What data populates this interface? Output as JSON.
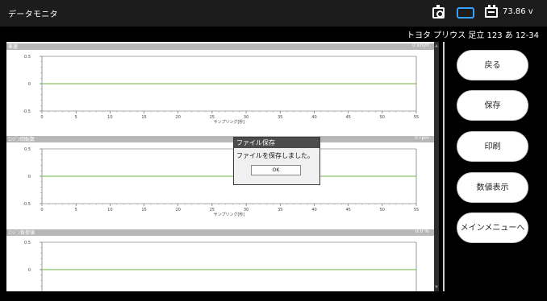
{
  "app": {
    "title": "データモニタ",
    "voltage": "73.86 v"
  },
  "header_icons": {
    "camera": "camera-icon",
    "connection": "vci-link-icon",
    "battery": "battery-icon",
    "connection_color": "#3aa0ff"
  },
  "vehicle": {
    "name": "トヨタ プリウス 足立 123 あ 12-34"
  },
  "charts": [
    {
      "label": "車速",
      "unit": "0 km/h",
      "xlabel": "サンプリング[秒]",
      "y_ticks": [
        "0.5",
        "0",
        "-0.5"
      ],
      "show_x_axis": true
    },
    {
      "label": "ｴﾝｼﾞﾝ回転数",
      "unit": "0 rpm",
      "xlabel": "サンプリング[秒]",
      "y_ticks": [
        "0.5",
        "0",
        "-0.5"
      ],
      "show_x_axis": true
    },
    {
      "label": "ｴﾝｼﾞﾝ負荷値",
      "unit": "0.0 %",
      "xlabel": "",
      "y_ticks": [
        "0.5",
        "0"
      ],
      "show_x_axis": false
    }
  ],
  "chart_data": [
    {
      "type": "line",
      "title": "車速",
      "xlabel": "サンプリング[秒]",
      "ylabel": "",
      "xlim": [
        0,
        55
      ],
      "ylim": [
        -0.5,
        0.5
      ],
      "x_ticks": [
        0,
        5,
        10,
        15,
        20,
        25,
        30,
        35,
        40,
        45,
        50,
        55
      ],
      "series": [
        {
          "x": [
            0,
            55
          ],
          "values": [
            0,
            0
          ]
        }
      ],
      "line_color": "#6db33f"
    },
    {
      "type": "line",
      "title": "ｴﾝｼﾞﾝ回転数",
      "xlabel": "サンプリング[秒]",
      "ylabel": "",
      "xlim": [
        0,
        55
      ],
      "ylim": [
        -0.5,
        0.5
      ],
      "x_ticks": [
        0,
        5,
        10,
        15,
        20,
        25,
        30,
        35,
        40,
        45,
        50,
        55
      ],
      "series": [
        {
          "x": [
            0,
            55
          ],
          "values": [
            0,
            0
          ]
        }
      ],
      "line_color": "#6db33f"
    },
    {
      "type": "line",
      "title": "ｴﾝｼﾞﾝ負荷値",
      "xlabel": "",
      "ylabel": "",
      "xlim": [
        0,
        55
      ],
      "ylim": [
        -0.5,
        0.5
      ],
      "x_ticks": [],
      "series": [
        {
          "x": [
            0,
            55
          ],
          "values": [
            0,
            0
          ]
        }
      ],
      "line_color": "#6db33f"
    }
  ],
  "side_menu": {
    "back": "戻る",
    "save": "保存",
    "print": "印刷",
    "numeric": "数値表示",
    "main_menu": "メインメニューへ"
  },
  "dialog": {
    "title": "ファイル保存",
    "message": "ファイルを保存しました。",
    "ok": "OK"
  }
}
